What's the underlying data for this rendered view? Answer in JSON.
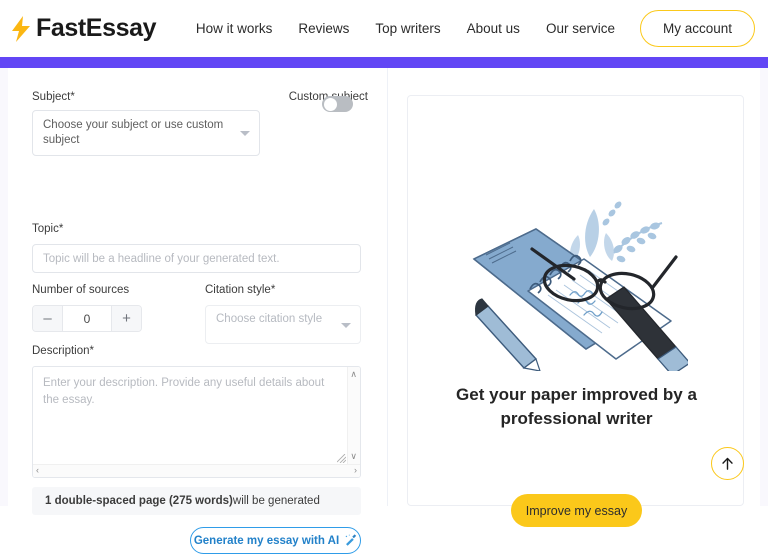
{
  "header": {
    "logo_text": "FastEssay",
    "logo_icon": "lightning-bolt-icon",
    "nav": [
      {
        "label": "How it works"
      },
      {
        "label": "Reviews"
      },
      {
        "label": "Top writers"
      },
      {
        "label": "About us"
      },
      {
        "label": "Our service"
      }
    ],
    "account_label": "My account",
    "accent_yellow": "#fbc81a",
    "bar_purple": "#6246f5"
  },
  "form": {
    "subject": {
      "label": "Subject*",
      "value": "Choose your subject or use custom subject",
      "caret_icon": "chevron-down-icon"
    },
    "custom_subject": {
      "label": "Custom subject",
      "state": "off"
    },
    "topic": {
      "label": "Topic*",
      "value": "",
      "placeholder": "Topic will be a headline of your generated text."
    },
    "sources": {
      "label": "Number of sources",
      "value": "0",
      "minus_label": "–",
      "plus_label": "+"
    },
    "citation": {
      "label": "Citation style*",
      "value": "Choose citation style",
      "caret_icon": "chevron-down-icon"
    },
    "description": {
      "label": "Description*",
      "value": "",
      "placeholder": "Enter your description. Provide any useful details about the essay.",
      "scroll_up_glyph": "∧",
      "scroll_down_glyph": "∨",
      "scroll_left_glyph": "‹",
      "scroll_right_glyph": "›"
    },
    "pagecount": {
      "strong": "1 double-spaced page (275 words)",
      "rest": " will be generated"
    },
    "generate_button": {
      "label": "Generate my essay with AI",
      "icon": "magic-wand-icon",
      "color": "#2281c9"
    }
  },
  "promo": {
    "illustration_name": "notepad-glasses-pen-illustration",
    "title": "Get your paper improved by a professional writer",
    "button_label": "Improve my essay",
    "button_color": "#fbc81a"
  },
  "scroll_top": {
    "icon": "arrow-up-icon",
    "border_color": "#fbc81a"
  }
}
